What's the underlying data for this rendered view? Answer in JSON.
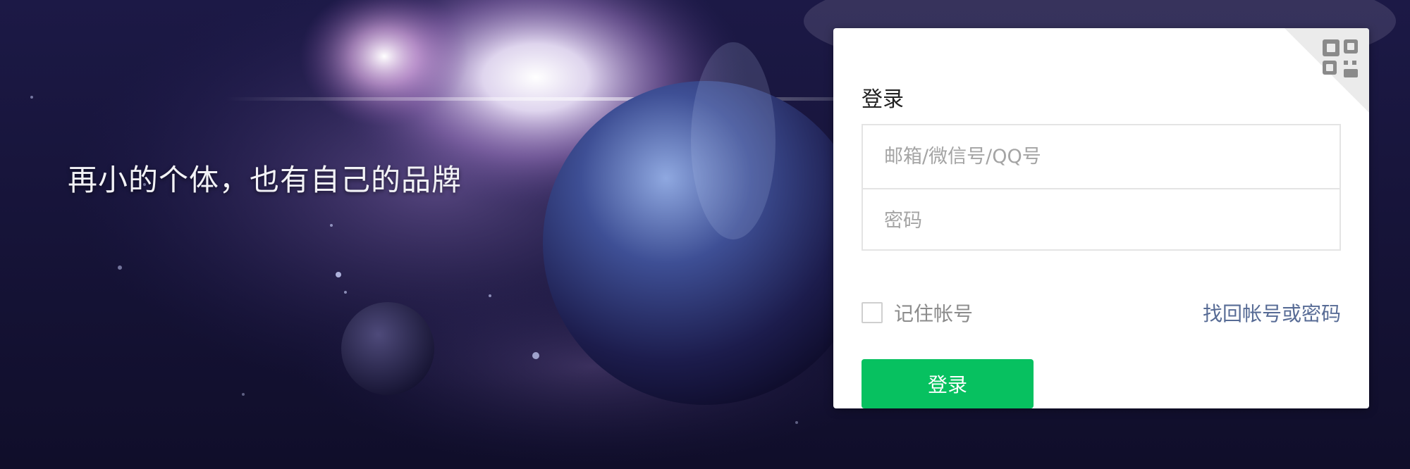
{
  "banner": {
    "slogan": "再小的个体，也有自己的品牌"
  },
  "login": {
    "title": "登录",
    "qr_icon": "qr-code-icon",
    "account_placeholder": "邮箱/微信号/QQ号",
    "password_placeholder": "密码",
    "remember_label": "记住帐号",
    "remember_checked": false,
    "forgot_label": "找回帐号或密码",
    "submit_label": "登录"
  },
  "colors": {
    "brand_green": "#07c160",
    "link": "#576b95",
    "background": "#17143a"
  }
}
